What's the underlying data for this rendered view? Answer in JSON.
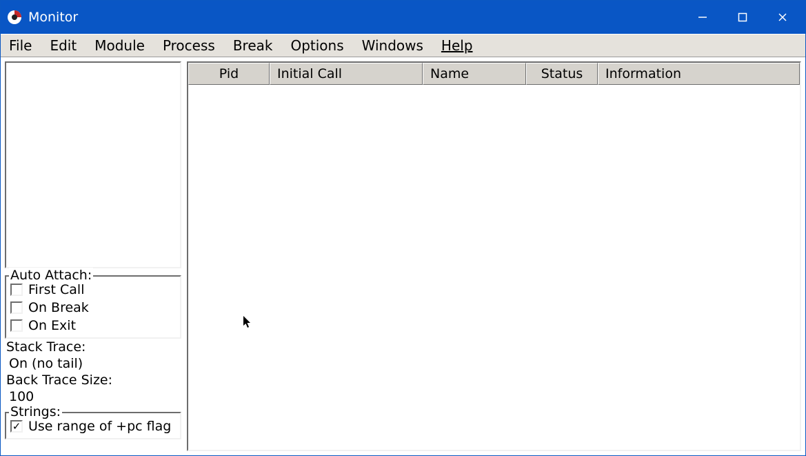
{
  "window": {
    "title": "Monitor"
  },
  "menus": {
    "file": "File",
    "edit": "Edit",
    "module": "Module",
    "process": "Process",
    "break": "Break",
    "options": "Options",
    "windows": "Windows",
    "help": "Help"
  },
  "sidebar": {
    "auto_attach": {
      "legend": "Auto Attach:",
      "first_call": {
        "label": "First Call",
        "checked": false
      },
      "on_break": {
        "label": "On Break",
        "checked": false
      },
      "on_exit": {
        "label": "On Exit",
        "checked": false
      }
    },
    "stack_trace_label": "Stack Trace:",
    "stack_trace_value": "On (no tail)",
    "back_trace_size_label": "Back Trace Size:",
    "back_trace_size_value": "100",
    "strings": {
      "legend": "Strings:",
      "use_range": {
        "label": "Use range of +pc flag",
        "checked": true
      }
    }
  },
  "table": {
    "columns": {
      "pid": "Pid",
      "initial_call": "Initial Call",
      "name": "Name",
      "status": "Status",
      "information": "Information"
    },
    "rows": []
  }
}
